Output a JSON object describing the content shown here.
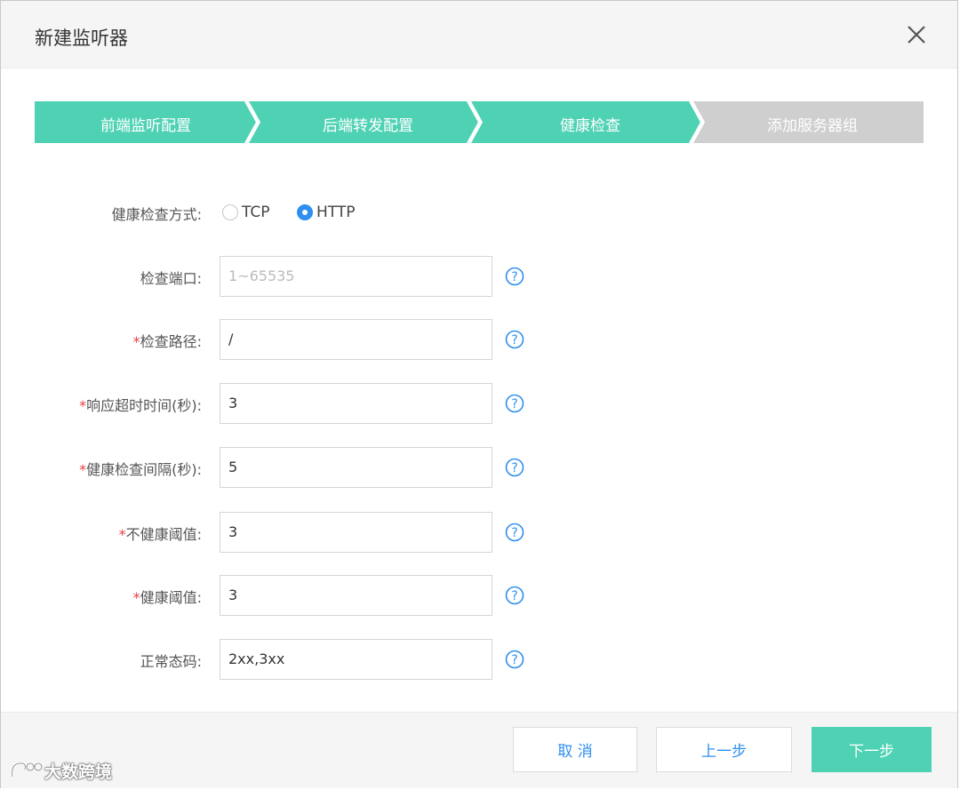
{
  "dialog": {
    "title": "新建监听器"
  },
  "steps": [
    {
      "label": "前端监听配置",
      "state": "done"
    },
    {
      "label": "后端转发配置",
      "state": "done"
    },
    {
      "label": "健康检查",
      "state": "active"
    },
    {
      "label": "添加服务器组",
      "state": "pending"
    }
  ],
  "colors": {
    "accent": "#4fd2b4",
    "pending": "#cfcfcf",
    "link": "#2e8ff0",
    "required": "#e64040"
  },
  "form": {
    "method": {
      "label": "健康检查方式:",
      "options": [
        "TCP",
        "HTTP"
      ],
      "selected": "HTTP"
    },
    "port": {
      "label": "检查端口:",
      "required": false,
      "value": "",
      "placeholder": "1~65535"
    },
    "path": {
      "label": "检查路径:",
      "required": true,
      "value": "/"
    },
    "timeout": {
      "label": "响应超时时间(秒):",
      "required": true,
      "value": "3"
    },
    "interval": {
      "label": "健康检查间隔(秒):",
      "required": true,
      "value": "5"
    },
    "unhealthy": {
      "label": "不健康阈值:",
      "required": true,
      "value": "3"
    },
    "healthy": {
      "label": "健康阈值:",
      "required": true,
      "value": "3"
    },
    "codes": {
      "label": "正常态码:",
      "required": false,
      "value": "2xx,3xx"
    },
    "required_mark": "*"
  },
  "footer": {
    "cancel_label": "取 消",
    "prev_label": "上一步",
    "next_label": "下一步"
  },
  "watermark": {
    "text": "大数跨境"
  },
  "icons": {
    "close": "close-icon",
    "help": "help-circle-icon"
  }
}
